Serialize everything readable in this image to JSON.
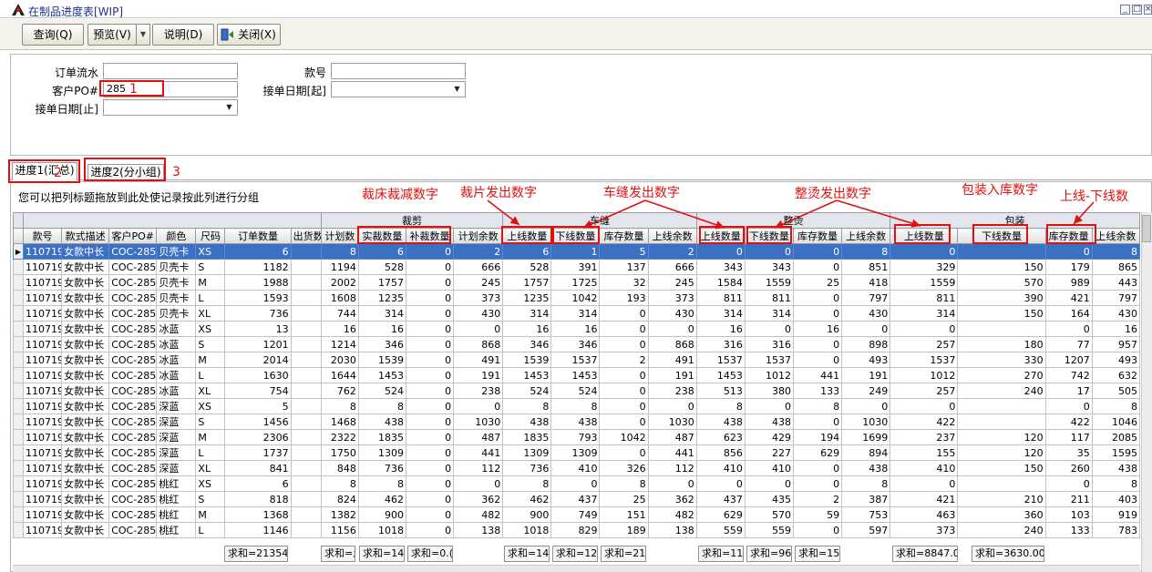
{
  "window": {
    "title": "在制品进度表[WIP]",
    "controls": [
      "_",
      "□",
      "×"
    ]
  },
  "toolbar": {
    "query_label": "查询(Q)",
    "preview_label": "预览(V)",
    "help_label": "说明(D)",
    "close_label": "关闭(X)"
  },
  "form": {
    "order_no_label": "订单流水",
    "order_no_value": "",
    "customer_po_label": "客户PO#",
    "customer_po_value": "285",
    "style_no_label": "款号",
    "style_no_value": "",
    "date_from_label": "接单日期[起]",
    "date_from_value": "",
    "date_to_label": "接单日期[止]",
    "date_to_value": ""
  },
  "tabs": [
    {
      "label": "进度1(汇总)"
    },
    {
      "label": "进度2(分小组)"
    }
  ],
  "grid": {
    "group_hint": "您可以把列标题拖放到此处使记录按此列进行分组",
    "group_headers": {
      "cutting": "裁剪",
      "sewing": "车缝",
      "ironing": "整烫",
      "packing": "包装"
    },
    "columns": [
      "款号",
      "款式描述",
      "客户PO#",
      "颜色",
      "尺码",
      "订单数量",
      "出货数",
      "计划数",
      "实裁数量",
      "补裁数量",
      "计划余数",
      "上线数量",
      "下线数量",
      "库存数量",
      "上线余数",
      "上线数量",
      "下线数量",
      "库存数量",
      "上线余数",
      "上线数量",
      "下线数量",
      "库存数量",
      "上线余数"
    ],
    "rows": [
      [
        "110719",
        "女款中长",
        "COC-285",
        "贝壳卡",
        "XS",
        "6",
        "",
        "8",
        "6",
        "0",
        "2",
        "6",
        "1",
        "5",
        "2",
        "0",
        "0",
        "0",
        "8",
        "0",
        "",
        "0",
        "8"
      ],
      [
        "110719",
        "女款中长",
        "COC-285",
        "贝壳卡",
        "S",
        "1182",
        "",
        "1194",
        "528",
        "0",
        "666",
        "528",
        "391",
        "137",
        "666",
        "343",
        "343",
        "0",
        "851",
        "329",
        "150",
        "179",
        "865"
      ],
      [
        "110719",
        "女款中长",
        "COC-285",
        "贝壳卡",
        "M",
        "1988",
        "",
        "2002",
        "1757",
        "0",
        "245",
        "1757",
        "1725",
        "32",
        "245",
        "1584",
        "1559",
        "25",
        "418",
        "1559",
        "570",
        "989",
        "443"
      ],
      [
        "110719",
        "女款中长",
        "COC-285",
        "贝壳卡",
        "L",
        "1593",
        "",
        "1608",
        "1235",
        "0",
        "373",
        "1235",
        "1042",
        "193",
        "373",
        "811",
        "811",
        "0",
        "797",
        "811",
        "390",
        "421",
        "797"
      ],
      [
        "110719",
        "女款中长",
        "COC-285",
        "贝壳卡",
        "XL",
        "736",
        "",
        "744",
        "314",
        "0",
        "430",
        "314",
        "314",
        "0",
        "430",
        "314",
        "314",
        "0",
        "430",
        "314",
        "150",
        "164",
        "430"
      ],
      [
        "110719",
        "女款中长",
        "COC-285",
        "冰蓝",
        "XS",
        "13",
        "",
        "16",
        "16",
        "0",
        "0",
        "16",
        "16",
        "0",
        "0",
        "16",
        "0",
        "16",
        "0",
        "0",
        "",
        "0",
        "16"
      ],
      [
        "110719",
        "女款中长",
        "COC-285",
        "冰蓝",
        "S",
        "1201",
        "",
        "1214",
        "346",
        "0",
        "868",
        "346",
        "346",
        "0",
        "868",
        "316",
        "316",
        "0",
        "898",
        "257",
        "180",
        "77",
        "957"
      ],
      [
        "110719",
        "女款中长",
        "COC-285",
        "冰蓝",
        "M",
        "2014",
        "",
        "2030",
        "1539",
        "0",
        "491",
        "1539",
        "1537",
        "2",
        "491",
        "1537",
        "1537",
        "0",
        "493",
        "1537",
        "330",
        "1207",
        "493"
      ],
      [
        "110719",
        "女款中长",
        "COC-285",
        "冰蓝",
        "L",
        "1630",
        "",
        "1644",
        "1453",
        "0",
        "191",
        "1453",
        "1453",
        "0",
        "191",
        "1453",
        "1012",
        "441",
        "191",
        "1012",
        "270",
        "742",
        "632"
      ],
      [
        "110719",
        "女款中长",
        "COC-285",
        "冰蓝",
        "XL",
        "754",
        "",
        "762",
        "524",
        "0",
        "238",
        "524",
        "524",
        "0",
        "238",
        "513",
        "380",
        "133",
        "249",
        "257",
        "240",
        "17",
        "505"
      ],
      [
        "110719",
        "女款中长",
        "COC-285",
        "深蓝",
        "XS",
        "5",
        "",
        "8",
        "8",
        "0",
        "0",
        "8",
        "8",
        "0",
        "0",
        "8",
        "0",
        "8",
        "0",
        "0",
        "",
        "0",
        "8"
      ],
      [
        "110719",
        "女款中长",
        "COC-285",
        "深蓝",
        "S",
        "1456",
        "",
        "1468",
        "438",
        "0",
        "1030",
        "438",
        "438",
        "0",
        "1030",
        "438",
        "438",
        "0",
        "1030",
        "422",
        "",
        "422",
        "1046"
      ],
      [
        "110719",
        "女款中长",
        "COC-285",
        "深蓝",
        "M",
        "2306",
        "",
        "2322",
        "1835",
        "0",
        "487",
        "1835",
        "793",
        "1042",
        "487",
        "623",
        "429",
        "194",
        "1699",
        "237",
        "120",
        "117",
        "2085"
      ],
      [
        "110719",
        "女款中长",
        "COC-285",
        "深蓝",
        "L",
        "1737",
        "",
        "1750",
        "1309",
        "0",
        "441",
        "1309",
        "1309",
        "0",
        "441",
        "856",
        "227",
        "629",
        "894",
        "155",
        "120",
        "35",
        "1595"
      ],
      [
        "110719",
        "女款中长",
        "COC-285",
        "深蓝",
        "XL",
        "841",
        "",
        "848",
        "736",
        "0",
        "112",
        "736",
        "410",
        "326",
        "112",
        "410",
        "410",
        "0",
        "438",
        "410",
        "150",
        "260",
        "438"
      ],
      [
        "110719",
        "女款中长",
        "COC-285",
        "桃红",
        "XS",
        "6",
        "",
        "8",
        "8",
        "0",
        "0",
        "8",
        "0",
        "8",
        "0",
        "0",
        "0",
        "0",
        "8",
        "0",
        "",
        "0",
        "8"
      ],
      [
        "110719",
        "女款中长",
        "COC-285",
        "桃红",
        "S",
        "818",
        "",
        "824",
        "462",
        "0",
        "362",
        "462",
        "437",
        "25",
        "362",
        "437",
        "435",
        "2",
        "387",
        "421",
        "210",
        "211",
        "403"
      ],
      [
        "110719",
        "女款中长",
        "COC-285",
        "桃红",
        "M",
        "1368",
        "",
        "1382",
        "900",
        "0",
        "482",
        "900",
        "749",
        "151",
        "482",
        "629",
        "570",
        "59",
        "753",
        "463",
        "360",
        "103",
        "919"
      ],
      [
        "110719",
        "女款中长",
        "COC-285",
        "桃红",
        "L",
        "1146",
        "",
        "1156",
        "1018",
        "0",
        "138",
        "1018",
        "829",
        "189",
        "138",
        "559",
        "559",
        "0",
        "597",
        "373",
        "240",
        "133",
        "783"
      ]
    ],
    "footer_sums": {
      "order_qty": "求和=21354.",
      "plan": "求和=;",
      "cut": "求和=14",
      "recut": "求和=0.(",
      "sew_in": "求和=14",
      "sew_out": "求和=12(",
      "sew_stock": "求和=21:",
      "iron_in": "求和=11:",
      "iron_out": "求和=964",
      "iron_stock": "求和=15",
      "pack_in": "求和=8847.0",
      "pack_out": "求和=3630.00"
    }
  },
  "annotations": {
    "n1": "1",
    "n2": "2",
    "n3": "3",
    "cut_reduce": "裁床裁减数字",
    "cut_out": "裁片发出数字",
    "sew_out": "车缝发出数字",
    "iron_out": "整烫发出数字",
    "pack_in": "包装入库数字",
    "in_minus_out": "上线-下线数"
  },
  "colors": {
    "selected_row": "#3b70c3",
    "annotation_red": "#e01010",
    "title_text": "#1c2f8f"
  }
}
